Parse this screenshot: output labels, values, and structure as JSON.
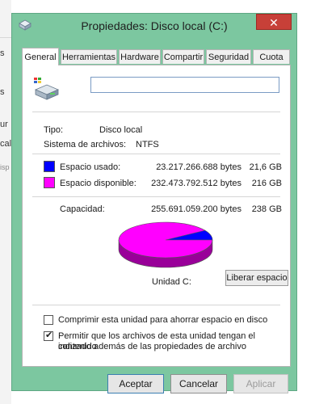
{
  "background": {
    "fragments": [
      "s",
      "s",
      "ur",
      "cal",
      "isp"
    ]
  },
  "window": {
    "title": "Propiedades: Disco local (C:)",
    "close_glyph": "✕"
  },
  "tabs": [
    "General",
    "Herramientas",
    "Hardware",
    "Compartir",
    "Seguridad",
    "Cuota"
  ],
  "general": {
    "name_value": "",
    "type_label": "Tipo:",
    "type_value": "Disco local",
    "fs_label": "Sistema de archivos:",
    "fs_value": "NTFS",
    "used": {
      "label": "Espacio usado:",
      "bytes": "23.217.266.688 bytes",
      "size": "21,6 GB",
      "color": "#0000ff"
    },
    "free": {
      "label": "Espacio disponible:",
      "bytes": "232.473.792.512 bytes",
      "size": "216 GB",
      "color": "#ff00ff"
    },
    "capacity": {
      "label": "Capacidad:",
      "bytes": "255.691.059.200 bytes",
      "size": "238 GB"
    },
    "drive_label": "Unidad C:",
    "cleanup_button": "Liberar espacio",
    "compress_text": "Comprimir esta unidad para ahorrar espacio en disco",
    "compress_checked": false,
    "index_text_1": "Permitir que los archivos de esta unidad tengan el contenido",
    "index_text_2": "indizado además de las propiedades de archivo",
    "index_checked": true
  },
  "buttons": {
    "accept": "Aceptar",
    "cancel": "Cancelar",
    "apply": "Aplicar"
  },
  "chart_data": {
    "type": "pie",
    "categories": [
      "Espacio usado",
      "Espacio disponible"
    ],
    "values": [
      23217266688,
      232473792512
    ],
    "colors": [
      "#0000ff",
      "#ff00ff"
    ]
  }
}
